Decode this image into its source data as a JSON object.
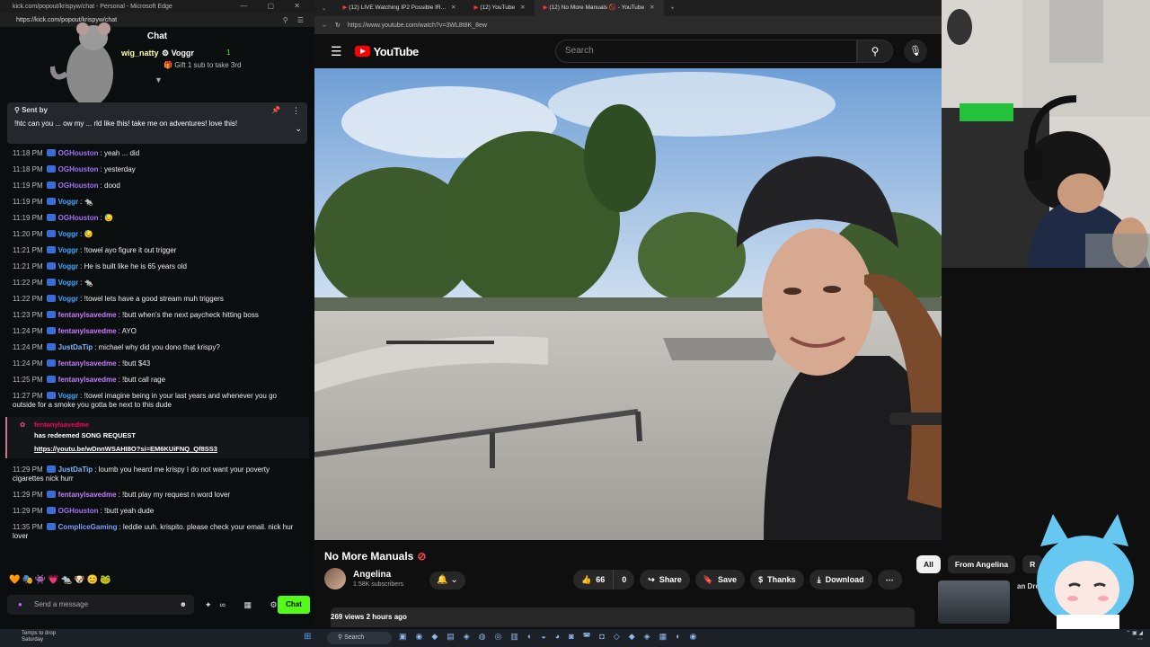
{
  "chat_window": {
    "title": "kick.com/popout/krispyw/chat - Personal - Microsoft Edge",
    "url": "https://kick.com/popout/krispyw/chat",
    "header": "Chat",
    "leaderboard": {
      "name1": "wig_natty",
      "name2": "Voggr",
      "count": "1",
      "gift_text": "Gift 1 sub to take 3rd"
    },
    "pinned": {
      "sent_by": "Sent by",
      "text": "!htc can you ... ow my ... rld like this! take me on adventures! love this!"
    },
    "messages": [
      {
        "time": "11:18 PM",
        "user": "OGHouston",
        "cls": "c-og",
        "text": "yeah ... did"
      },
      {
        "time": "11:18 PM",
        "user": "OGHouston",
        "cls": "c-og",
        "text": "yesterday"
      },
      {
        "time": "11:19 PM",
        "user": "OGHouston",
        "cls": "c-og",
        "text": "dood"
      },
      {
        "time": "11:19 PM",
        "user": "Voggr",
        "cls": "c-vog",
        "text": "🐀"
      },
      {
        "time": "11:19 PM",
        "user": "OGHouston",
        "cls": "c-og",
        "text": "😓"
      },
      {
        "time": "11:20 PM",
        "user": "Voggr",
        "cls": "c-vog",
        "text": "😓"
      },
      {
        "time": "11:21 PM",
        "user": "Voggr",
        "cls": "c-vog",
        "text": "!towel ayo figure it out trigger"
      },
      {
        "time": "11:21 PM",
        "user": "Voggr",
        "cls": "c-vog",
        "text": "He is built like he is 65 years old"
      },
      {
        "time": "11:22 PM",
        "user": "Voggr",
        "cls": "c-vog",
        "text": "🐀"
      },
      {
        "time": "11:22 PM",
        "user": "Voggr",
        "cls": "c-vog",
        "text": "!towel lets have a good stream muh triggers"
      },
      {
        "time": "11:23 PM",
        "user": "fentanylsavedme",
        "cls": "c-fen",
        "text": "!butt when's the next paycheck hitting boss"
      },
      {
        "time": "11:24 PM",
        "user": "fentanylsavedme",
        "cls": "c-fen",
        "text": "AYO"
      },
      {
        "time": "11:24 PM",
        "user": "JustDaTip",
        "cls": "c-jus",
        "text": "michael why did you dono that krispy?"
      },
      {
        "time": "11:24 PM",
        "user": "fentanylsavedme",
        "cls": "c-fen",
        "text": "!butt $43"
      },
      {
        "time": "11:25 PM",
        "user": "fentanylsavedme",
        "cls": "c-fen",
        "text": "!butt call rage"
      },
      {
        "time": "11:27 PM",
        "user": "Voggr",
        "cls": "c-vog",
        "text": "!towel imagine being in your last years and whenever you go outside for a smoke you gotta be next to this dude"
      }
    ],
    "redeem": {
      "user": "fentanylsavedme",
      "label": "has redeemed SONG REQUEST",
      "link": "https://youtu.be/wDnnWSAHI8O?si=EM6KUiFNQ_Qf8SS3"
    },
    "messages2": [
      {
        "time": "11:29 PM",
        "user": "JustDaTip",
        "cls": "c-jus",
        "text": "loumb you heard me krispy I do not want your poverty cigarettes nick hurr"
      },
      {
        "time": "11:29 PM",
        "user": "fentanylsavedme",
        "cls": "c-fen",
        "text": "!butt play my request n word lover"
      },
      {
        "time": "11:29 PM",
        "user": "OGHouston",
        "cls": "c-og",
        "text": "!butt yeah dude"
      },
      {
        "time": "11:35 PM",
        "user": "CompliceGaming",
        "cls": "c-comp",
        "text": "leddie uuh. krispito. please check your email. nick hur lover"
      }
    ],
    "emotes": "🧡🎭👾💗🐀🐶😊🐸",
    "input_placeholder": "Send a message",
    "chat_button": "Chat"
  },
  "youtube": {
    "tabs": [
      {
        "label": "(12) LIVE Watching IP2 Possible IR...",
        "active": false
      },
      {
        "label": "(12) YouTube",
        "active": false
      },
      {
        "label": "(12) No More Manuals 🚫 - YouTube",
        "active": true
      }
    ],
    "url": "https://www.youtube.com/watch?v=3WL8t8K_8ew",
    "logo_text": "YouTube",
    "search_placeholder": "Search",
    "video_title": "No More Manuals",
    "channel_name": "Angelina",
    "subscribers": "1.58K subscribers",
    "likes": "66",
    "dislikes": "0",
    "share": "Share",
    "save": "Save",
    "thanks": "Thanks",
    "download": "Download",
    "views_line": "269 views  2 hours ago",
    "chips": [
      "All",
      "From Angelina",
      "R"
    ],
    "rec_title": "an Dre"
  },
  "taskbar": {
    "weather_line1": "Temps to drop",
    "weather_line2": "Saturday",
    "search": "Search"
  },
  "colors": {
    "kick_green": "#53fc18",
    "youtube_red": "#ff0000",
    "background": "#0f0f0f"
  }
}
